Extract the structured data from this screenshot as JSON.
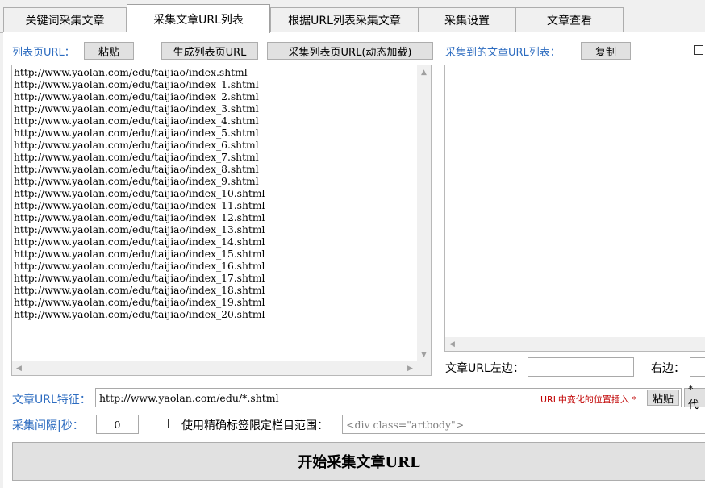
{
  "tabs": [
    {
      "label": "关键词采集文章"
    },
    {
      "label": "采集文章URL列表"
    },
    {
      "label": "根据URL列表采集文章"
    },
    {
      "label": "采集设置"
    },
    {
      "label": "文章查看"
    }
  ],
  "list_page": {
    "label": "列表页URL：",
    "paste_button": "粘贴",
    "generate_button": "生成列表页URL",
    "collect_button": "采集列表页URL(动态加载)",
    "urls": [
      "http://www.yaolan.com/edu/taijiao/index.shtml",
      "http://www.yaolan.com/edu/taijiao/index_1.shtml",
      "http://www.yaolan.com/edu/taijiao/index_2.shtml",
      "http://www.yaolan.com/edu/taijiao/index_3.shtml",
      "http://www.yaolan.com/edu/taijiao/index_4.shtml",
      "http://www.yaolan.com/edu/taijiao/index_5.shtml",
      "http://www.yaolan.com/edu/taijiao/index_6.shtml",
      "http://www.yaolan.com/edu/taijiao/index_7.shtml",
      "http://www.yaolan.com/edu/taijiao/index_8.shtml",
      "http://www.yaolan.com/edu/taijiao/index_9.shtml",
      "http://www.yaolan.com/edu/taijiao/index_10.shtml",
      "http://www.yaolan.com/edu/taijiao/index_11.shtml",
      "http://www.yaolan.com/edu/taijiao/index_12.shtml",
      "http://www.yaolan.com/edu/taijiao/index_13.shtml",
      "http://www.yaolan.com/edu/taijiao/index_14.shtml",
      "http://www.yaolan.com/edu/taijiao/index_15.shtml",
      "http://www.yaolan.com/edu/taijiao/index_16.shtml",
      "http://www.yaolan.com/edu/taijiao/index_17.shtml",
      "http://www.yaolan.com/edu/taijiao/index_18.shtml",
      "http://www.yaolan.com/edu/taijiao/index_19.shtml",
      "http://www.yaolan.com/edu/taijiao/index_20.shtml"
    ]
  },
  "collected": {
    "label": "采集到的文章URL列表：",
    "copy_button": "复制",
    "left_label": "文章URL左边：",
    "left_value": "",
    "right_label": "右边：",
    "right_value": ""
  },
  "feature": {
    "label": "文章URL特征：",
    "value": "http://www.yaolan.com/edu/*.shtml",
    "hint": "URL中变化的位置插入 *",
    "paste_button": "粘贴",
    "star_button": "* 代"
  },
  "interval": {
    "label": "采集间隔|秒：",
    "value": "0",
    "precise_label": "使用精确标签限定栏目范围：",
    "precise_placeholder": "<div class=\"artbody\">"
  },
  "start_button": "开始采集文章URL",
  "colors": {
    "label_blue": "#2d6cc0",
    "hint_red": "#c00000"
  },
  "icons": {
    "scroll_up": "▲",
    "scroll_down": "▼",
    "scroll_left": "◀",
    "scroll_right": "▶"
  }
}
